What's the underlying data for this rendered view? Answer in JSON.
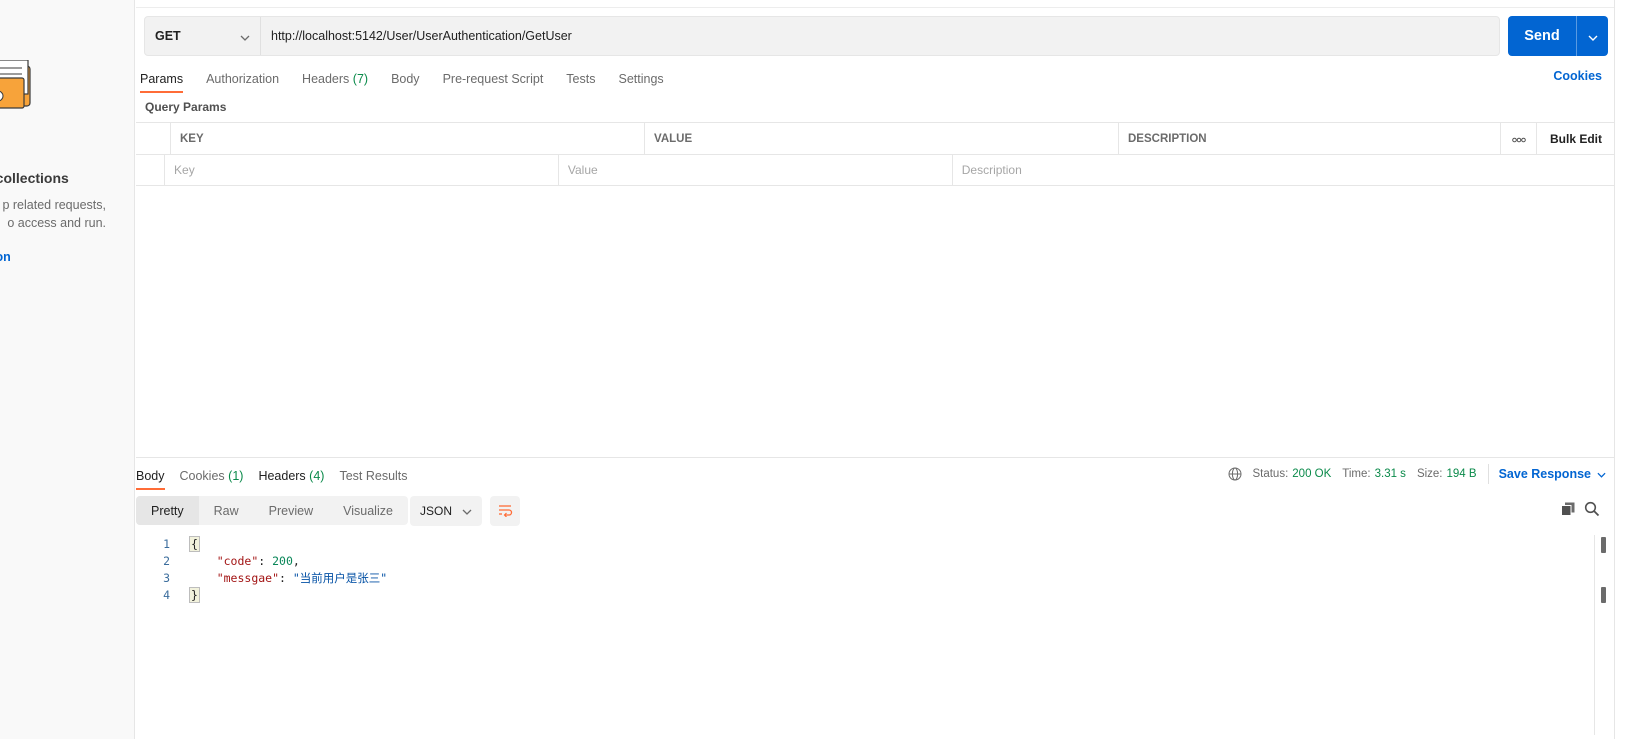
{
  "sidebar": {
    "empty_title": "y collections",
    "empty_desc_line1": "p related requests,",
    "empty_desc_line2": "o access and run.",
    "create_link": "ection"
  },
  "request": {
    "method": "GET",
    "url": "http://localhost:5142/User/UserAuthentication/GetUser",
    "send_label": "Send",
    "tabs": [
      {
        "label": "Params",
        "count": ""
      },
      {
        "label": "Authorization",
        "count": ""
      },
      {
        "label": "Headers",
        "count": "(7)"
      },
      {
        "label": "Body",
        "count": ""
      },
      {
        "label": "Pre-request Script",
        "count": ""
      },
      {
        "label": "Tests",
        "count": ""
      },
      {
        "label": "Settings",
        "count": ""
      }
    ],
    "cookies_link": "Cookies",
    "query_params_title": "Query Params",
    "params_table": {
      "headers": {
        "key": "KEY",
        "value": "VALUE",
        "description": "DESCRIPTION",
        "bulk_edit": "Bulk Edit"
      },
      "placeholders": {
        "key": "Key",
        "value": "Value",
        "description": "Description"
      }
    }
  },
  "response": {
    "tabs": [
      {
        "label": "Body",
        "count": ""
      },
      {
        "label": "Cookies",
        "count": "(1)"
      },
      {
        "label": "Headers",
        "count": "(4)"
      },
      {
        "label": "Test Results",
        "count": ""
      }
    ],
    "status_label": "Status:",
    "status_value": "200 OK",
    "time_label": "Time:",
    "time_value": "3.31 s",
    "size_label": "Size:",
    "size_value": "194 B",
    "save_response": "Save Response",
    "views": [
      "Pretty",
      "Raw",
      "Preview",
      "Visualize"
    ],
    "format": "JSON",
    "code_lines": [
      {
        "num": "1"
      },
      {
        "num": "2",
        "key": "\"code\"",
        "value": "200"
      },
      {
        "num": "3",
        "key": "\"messgae\"",
        "value": "\"当前用户是张三\""
      },
      {
        "num": "4"
      }
    ]
  },
  "colors": {
    "accent": "#0265d2",
    "tab_underline": "#ff6c37",
    "status_ok": "#0a8a4a"
  },
  "icons": [
    "chevron-down-icon",
    "globe-icon",
    "wrap-icon",
    "copy-icon",
    "search-icon",
    "more-icon"
  ]
}
